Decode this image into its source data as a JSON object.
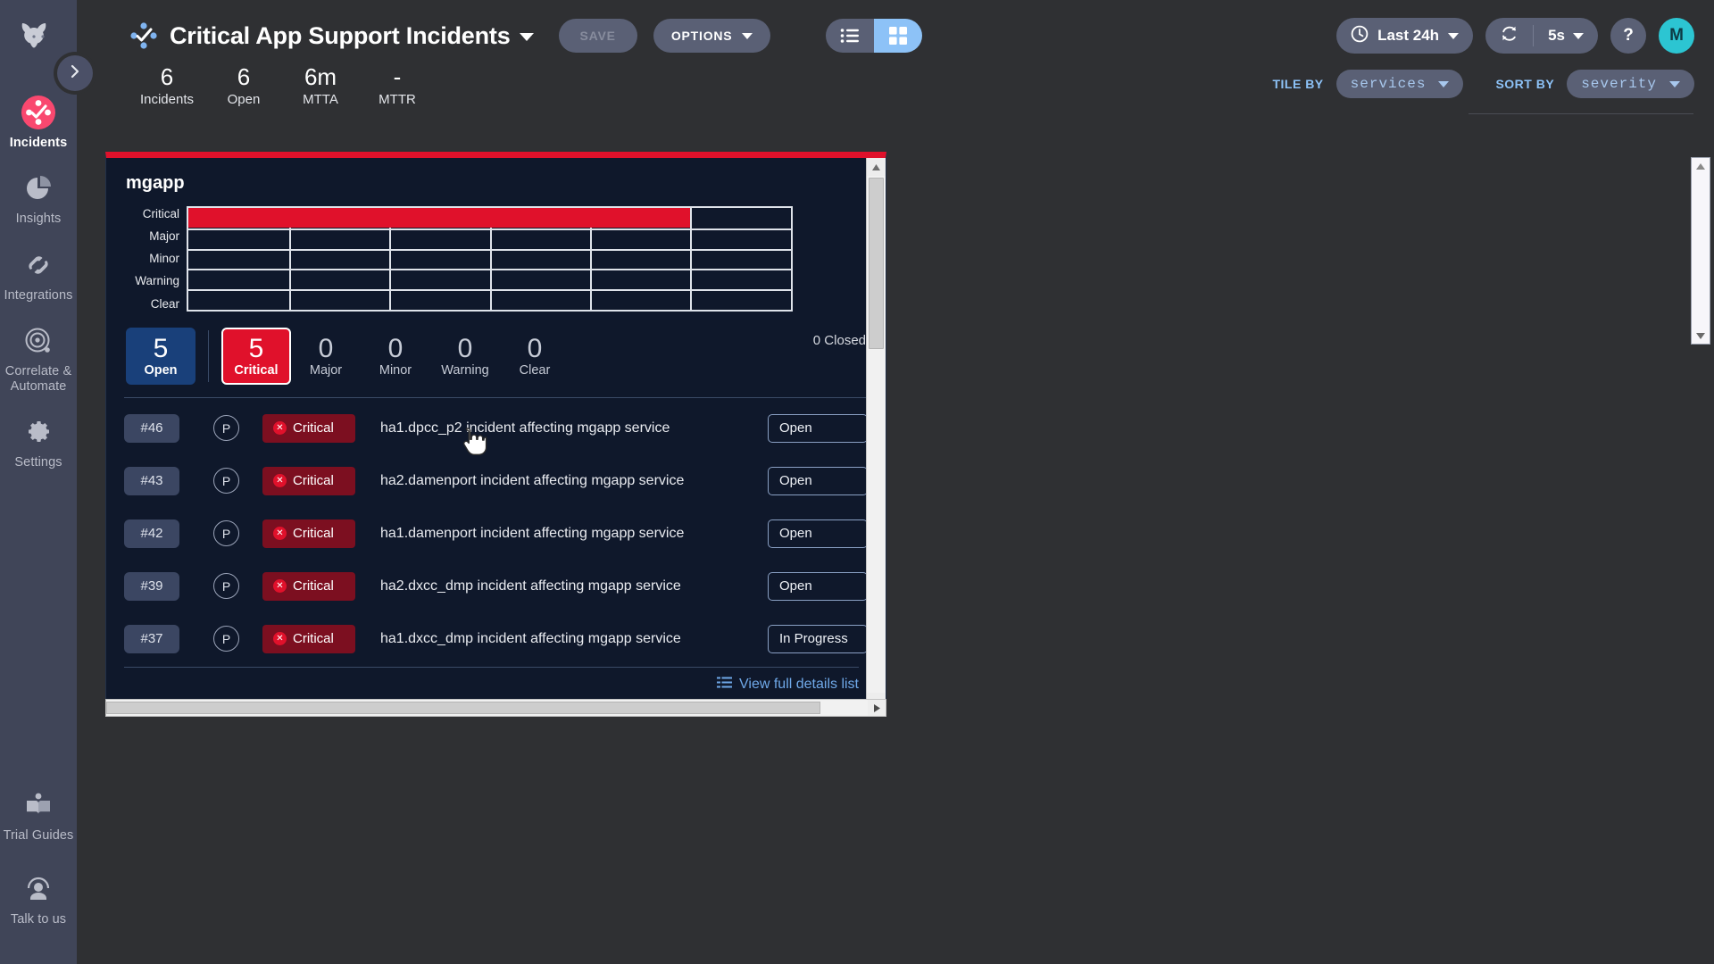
{
  "sidebar": {
    "brand_icon": "bull-logo",
    "expand_icon": "chevron-right-icon",
    "items": [
      {
        "label": "Incidents",
        "icon": "incidents-icon",
        "active": true
      },
      {
        "label": "Insights",
        "icon": "pie-chart-icon",
        "active": false
      },
      {
        "label": "Integrations",
        "icon": "integrations-icon",
        "active": false
      },
      {
        "label": "Correlate & Automate",
        "icon": "target-icon",
        "active": false
      },
      {
        "label": "Settings",
        "icon": "gear-icon",
        "active": false
      }
    ],
    "bottom_items": [
      {
        "label": "Trial Guides",
        "icon": "book-icon"
      },
      {
        "label": "Talk to us",
        "icon": "support-agent-icon"
      }
    ]
  },
  "topbar": {
    "logo_icon": "dashboard-dots-check-icon",
    "title": "Critical App Support Incidents",
    "title_caret": "chevron-down-icon",
    "save_label": "SAVE",
    "options_label": "OPTIONS",
    "view_list_icon": "list-view-icon",
    "view_grid_icon": "grid-view-icon",
    "active_view": "grid",
    "time_range": "Last 24h",
    "time_icon": "clock-icon",
    "refresh_icon": "refresh-icon",
    "refresh_interval": "5s",
    "help_label": "?",
    "avatar_initial": "M"
  },
  "stats": [
    {
      "value": "6",
      "label": "Incidents"
    },
    {
      "value": "6",
      "label": "Open"
    },
    {
      "value": "6m",
      "label": "MTTA"
    },
    {
      "value": "-",
      "label": "MTTR"
    }
  ],
  "filters": {
    "tile_by_label": "TILE BY",
    "tile_by_value": "services",
    "sort_by_label": "SORT BY",
    "sort_by_value": "severity"
  },
  "card": {
    "accent_color": "#e0112b",
    "title": "mgapp",
    "closed_label": "0 Closed",
    "details_link": "View full details list",
    "details_icon": "list-icon",
    "severity_counts": [
      {
        "label": "Open",
        "value": "5",
        "style": "open"
      },
      {
        "label": "Critical",
        "value": "5",
        "style": "critical"
      },
      {
        "label": "Major",
        "value": "0",
        "style": "plain"
      },
      {
        "label": "Minor",
        "value": "0",
        "style": "plain"
      },
      {
        "label": "Warning",
        "value": "0",
        "style": "plain"
      },
      {
        "label": "Clear",
        "value": "0",
        "style": "plain"
      }
    ],
    "incidents": [
      {
        "id": "#46",
        "priority": "P",
        "severity": "Critical",
        "title": "ha1.dpcc_p2 incident affecting mgapp service",
        "status": "Open"
      },
      {
        "id": "#43",
        "priority": "P",
        "severity": "Critical",
        "title": "ha2.damenport incident affecting mgapp service",
        "status": "Open"
      },
      {
        "id": "#42",
        "priority": "P",
        "severity": "Critical",
        "title": "ha1.damenport incident affecting mgapp service",
        "status": "Open"
      },
      {
        "id": "#39",
        "priority": "P",
        "severity": "Critical",
        "title": "ha2.dxcc_dmp incident affecting mgapp service",
        "status": "Open"
      },
      {
        "id": "#37",
        "priority": "P",
        "severity": "Critical",
        "title": "ha1.dxcc_dmp incident affecting mgapp service",
        "status": "In Progress"
      }
    ]
  },
  "chart_data": {
    "type": "heatmap",
    "title": "mgapp",
    "xlabel": "",
    "ylabel": "",
    "categories": [
      "Critical",
      "Major",
      "Minor",
      "Warning",
      "Clear"
    ],
    "values": [
      83,
      0,
      0,
      0,
      0
    ],
    "series": [
      {
        "name": "Critical",
        "color": "#e0112b",
        "start_pct": 0,
        "end_pct": 83
      },
      {
        "name": "Major",
        "color": "#e0112b",
        "start_pct": 0,
        "end_pct": 0
      },
      {
        "name": "Minor",
        "color": "#e0112b",
        "start_pct": 0,
        "end_pct": 0
      },
      {
        "name": "Warning",
        "color": "#e0112b",
        "start_pct": 0,
        "end_pct": 0
      },
      {
        "name": "Clear",
        "color": "#e0112b",
        "start_pct": 0,
        "end_pct": 0
      }
    ],
    "xlim": [
      0,
      100
    ],
    "gridlines_x": [
      16.7,
      33.3,
      50,
      66.7,
      83.3
    ],
    "grid": true,
    "legend": "none"
  }
}
